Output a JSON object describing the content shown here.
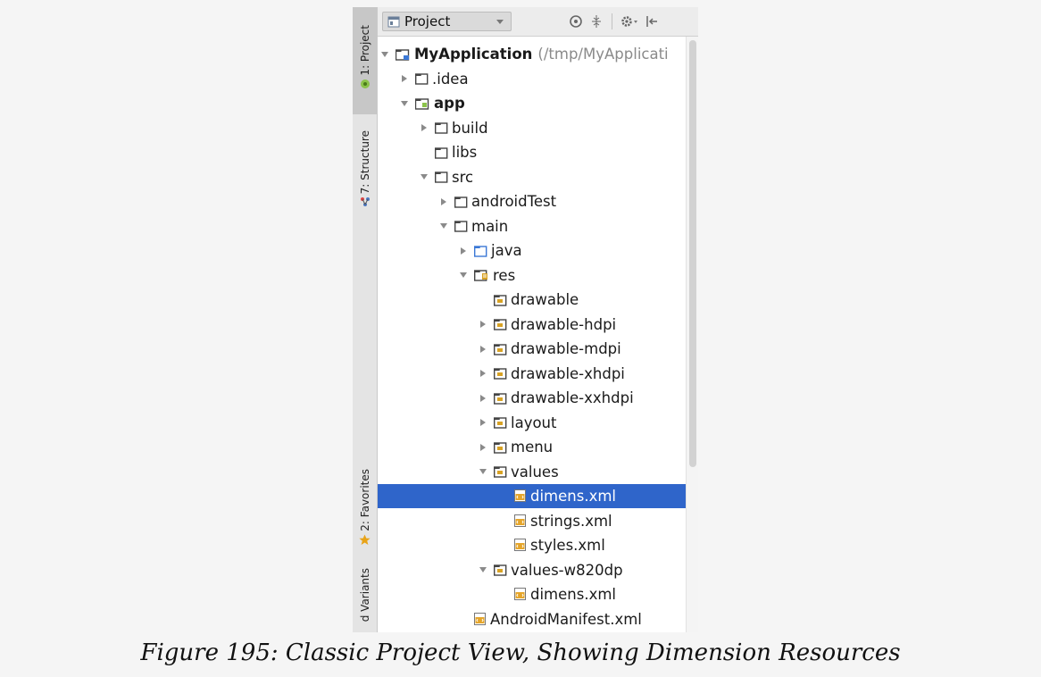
{
  "tool_window_strip": {
    "tabs": [
      {
        "label": "1: Project",
        "active": true
      },
      {
        "label": "7: Structure",
        "active": false
      },
      {
        "label": "2: Favorites",
        "active": false
      },
      {
        "label": "d Variants",
        "active": false
      }
    ]
  },
  "header": {
    "view_selector": "Project",
    "icons": [
      "sync-icon",
      "collapse-all-icon",
      "settings-icon",
      "hide-icon"
    ]
  },
  "tree": {
    "root": {
      "label": "MyApplication",
      "path": "(/tmp/MyApplicati"
    },
    "items": [
      {
        "label": ".idea"
      },
      {
        "label": "app"
      },
      {
        "label": "build"
      },
      {
        "label": "libs"
      },
      {
        "label": "src"
      },
      {
        "label": "androidTest"
      },
      {
        "label": "main"
      },
      {
        "label": "java"
      },
      {
        "label": "res"
      },
      {
        "label": "drawable"
      },
      {
        "label": "drawable-hdpi"
      },
      {
        "label": "drawable-mdpi"
      },
      {
        "label": "drawable-xhdpi"
      },
      {
        "label": "drawable-xxhdpi"
      },
      {
        "label": "layout"
      },
      {
        "label": "menu"
      },
      {
        "label": "values"
      },
      {
        "label": "dimens.xml",
        "selected": true
      },
      {
        "label": "strings.xml"
      },
      {
        "label": "styles.xml"
      },
      {
        "label": "values-w820dp"
      },
      {
        "label": "dimens.xml"
      },
      {
        "label": "AndroidManifest.xml"
      }
    ]
  },
  "colors": {
    "selection": "#2f65ca",
    "folder": "#444444",
    "res_folder_accent": "#d8a224",
    "xml_icon": "#e5a52a"
  },
  "caption": "Figure 195: Classic Project View, Showing Dimension Resources"
}
